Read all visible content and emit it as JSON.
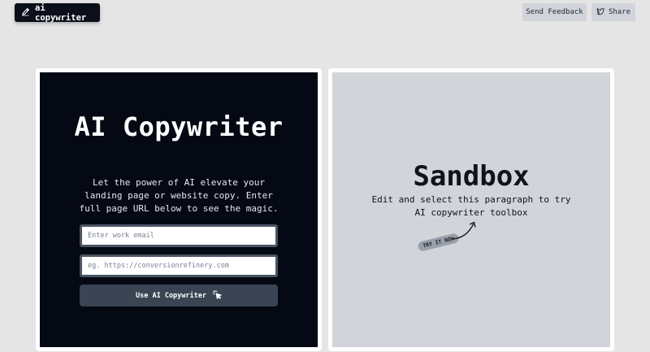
{
  "header": {
    "brand_label": "ai copywriter",
    "send_feedback_label": "Send Feedback",
    "share_label": "Share"
  },
  "left_panel": {
    "title": "AI Copywriter",
    "description": "Let the power of AI elevate your landing page or website copy. Enter full page URL below to see the magic.",
    "email_placeholder": "Enter work email",
    "url_placeholder": "eg. https://conversionrefinery.com",
    "cta_label": "Use AI Copywriter"
  },
  "right_panel": {
    "title": "Sandbox",
    "description": "Edit and select this paragraph to try AI copywriter toolbox",
    "try_label": "TRY IT NOW"
  },
  "colors": {
    "background": "#e5e5e5",
    "dark_panel": "#050914",
    "sandbox_panel": "#d1d4d9",
    "cta_button": "#3a4452"
  }
}
